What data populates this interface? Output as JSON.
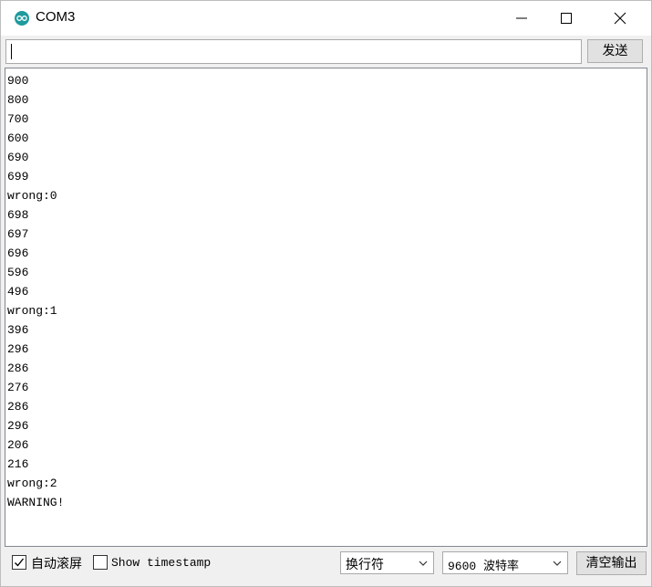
{
  "window": {
    "title": "COM3"
  },
  "input": {
    "value": "",
    "send_label": "发送"
  },
  "output_lines": [
    "900",
    "800",
    "700",
    "600",
    "690",
    "699",
    "wrong:0",
    "698",
    "697",
    "696",
    "596",
    "496",
    "wrong:1",
    "396",
    "296",
    "286",
    "276",
    "286",
    "296",
    "206",
    "216",
    "wrong:2",
    "WARNING!"
  ],
  "bottom": {
    "autoscroll_label": "自动滚屏",
    "autoscroll_checked": true,
    "timestamp_label": "Show timestamp",
    "timestamp_checked": false,
    "line_ending_value": "换行符",
    "baud_value": "9600 波特率",
    "clear_label": "清空输出"
  },
  "colors": {
    "app_icon": "#1f9a9d"
  }
}
